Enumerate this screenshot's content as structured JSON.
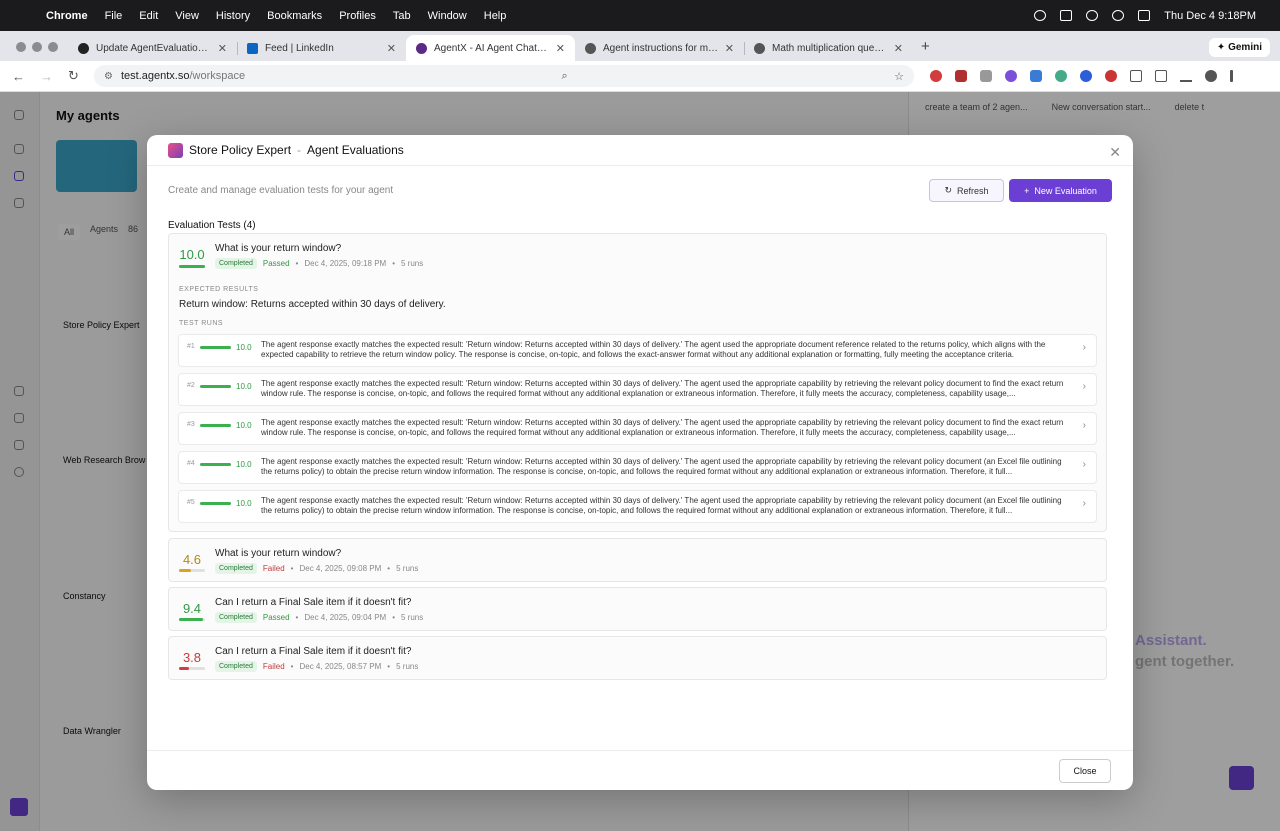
{
  "menubar": {
    "app": "Chrome",
    "items": [
      "File",
      "Edit",
      "View",
      "History",
      "Bookmarks",
      "Profiles",
      "Tab",
      "Window",
      "Help"
    ],
    "clock": "Thu Dec 4  9:18PM"
  },
  "tabs": [
    {
      "title": "Update AgentEvaluationCard",
      "fav": "#222"
    },
    {
      "title": "Feed | LinkedIn",
      "fav": "#0a66c2"
    },
    {
      "title": "AgentX - AI Agent Chatbot Bu",
      "fav": "#5b2a86"
    },
    {
      "title": "Agent instructions for math e",
      "fav": "#555"
    },
    {
      "title": "Math multiplication question",
      "fav": "#555"
    }
  ],
  "gemini_label": "Gemini",
  "address": {
    "host": "test.agentx.so",
    "path": "/workspace"
  },
  "background": {
    "panel_title": "My agents",
    "chips": [
      "All",
      "Agents",
      "86"
    ],
    "agents": [
      "Store Policy Expert",
      "Web Research Brow",
      "Constancy",
      "Data Wrangler"
    ],
    "right_tabs": [
      "create a team of 2 agen...",
      "New conversation start...",
      "delete t"
    ],
    "promo": [
      "Assistant.",
      "gent together."
    ]
  },
  "modal": {
    "agent_name": "Store Policy Expert",
    "separator": "-",
    "heading": "Agent Evaluations",
    "subtitle": "Create and manage evaluation tests for your agent",
    "refresh_label": "Refresh",
    "new_label": "New Evaluation",
    "section_title": "Evaluation Tests (4)",
    "close_label": "Close",
    "expected_label": "EXPECTED RESULTS",
    "runs_label": "TEST RUNS",
    "evaluations": [
      {
        "score": "10.0",
        "score_pct": 100,
        "color": "#3bb04f",
        "tone": "g",
        "question": "What is your return window?",
        "status": "Completed",
        "result": "Passed",
        "date": "Dec 4, 2025, 09:18 PM",
        "runs": "5 runs",
        "expected": "Return window: Returns accepted within 30 days of delivery.",
        "test_runs": [
          {
            "n": "#1",
            "score": "10.0",
            "text": "The agent response exactly matches the expected result: 'Return window: Returns accepted within 30 days of delivery.' The agent used the appropriate document reference related to the returns policy, which aligns with the expected capability to retrieve the return window policy. The response is concise, on-topic, and follows the exact-answer format without any additional explanation or formatting, fully meeting the acceptance criteria."
          },
          {
            "n": "#2",
            "score": "10.0",
            "text": "The agent response exactly matches the expected result: 'Return window: Returns accepted within 30 days of delivery.' The agent used the appropriate capability by retrieving the relevant policy document to find the exact return window rule. The response is concise, on-topic, and follows the required format without any additional explanation or extraneous information. Therefore, it fully meets the accuracy, completeness, capability usage,..."
          },
          {
            "n": "#3",
            "score": "10.0",
            "text": "The agent response exactly matches the expected result: 'Return window: Returns accepted within 30 days of delivery.' The agent used the appropriate capability by retrieving the relevant policy document to find the exact return window rule. The response is concise, on-topic, and follows the required format without any additional explanation or extraneous information. Therefore, it fully meets the accuracy, completeness, capability usage,..."
          },
          {
            "n": "#4",
            "score": "10.0",
            "text": "The agent response exactly matches the expected result: 'Return window: Returns accepted within 30 days of delivery.' The agent used the appropriate capability by retrieving the relevant policy document (an Excel file outlining the returns policy) to obtain the precise return window information. The response is concise, on-topic, and follows the required format without any additional explanation or extraneous information. Therefore, it full..."
          },
          {
            "n": "#5",
            "score": "10.0",
            "text": "The agent response exactly matches the expected result: 'Return window: Returns accepted within 30 days of delivery.' The agent used the appropriate capability by retrieving the relevant policy document (an Excel file outlining the returns policy) to obtain the precise return window information. The response is concise, on-topic, and follows the required format without any additional explanation or extraneous information. Therefore, it full..."
          }
        ]
      },
      {
        "score": "4.6",
        "score_pct": 46,
        "color": "#d9a520",
        "tone": "y",
        "question": "What is your return window?",
        "status": "Completed",
        "result": "Failed",
        "date": "Dec 4, 2025, 09:08 PM",
        "runs": "5 runs"
      },
      {
        "score": "9.4",
        "score_pct": 94,
        "color": "#3bb04f",
        "tone": "g",
        "question": "Can I return a Final Sale item if it doesn't fit?",
        "status": "Completed",
        "result": "Passed",
        "date": "Dec 4, 2025, 09:04 PM",
        "runs": "5 runs"
      },
      {
        "score": "3.8",
        "score_pct": 38,
        "color": "#d23c3c",
        "tone": "r",
        "question": "Can I return a Final Sale item if it doesn't fit?",
        "status": "Completed",
        "result": "Failed",
        "date": "Dec 4, 2025, 08:57 PM",
        "runs": "5 runs"
      }
    ]
  }
}
